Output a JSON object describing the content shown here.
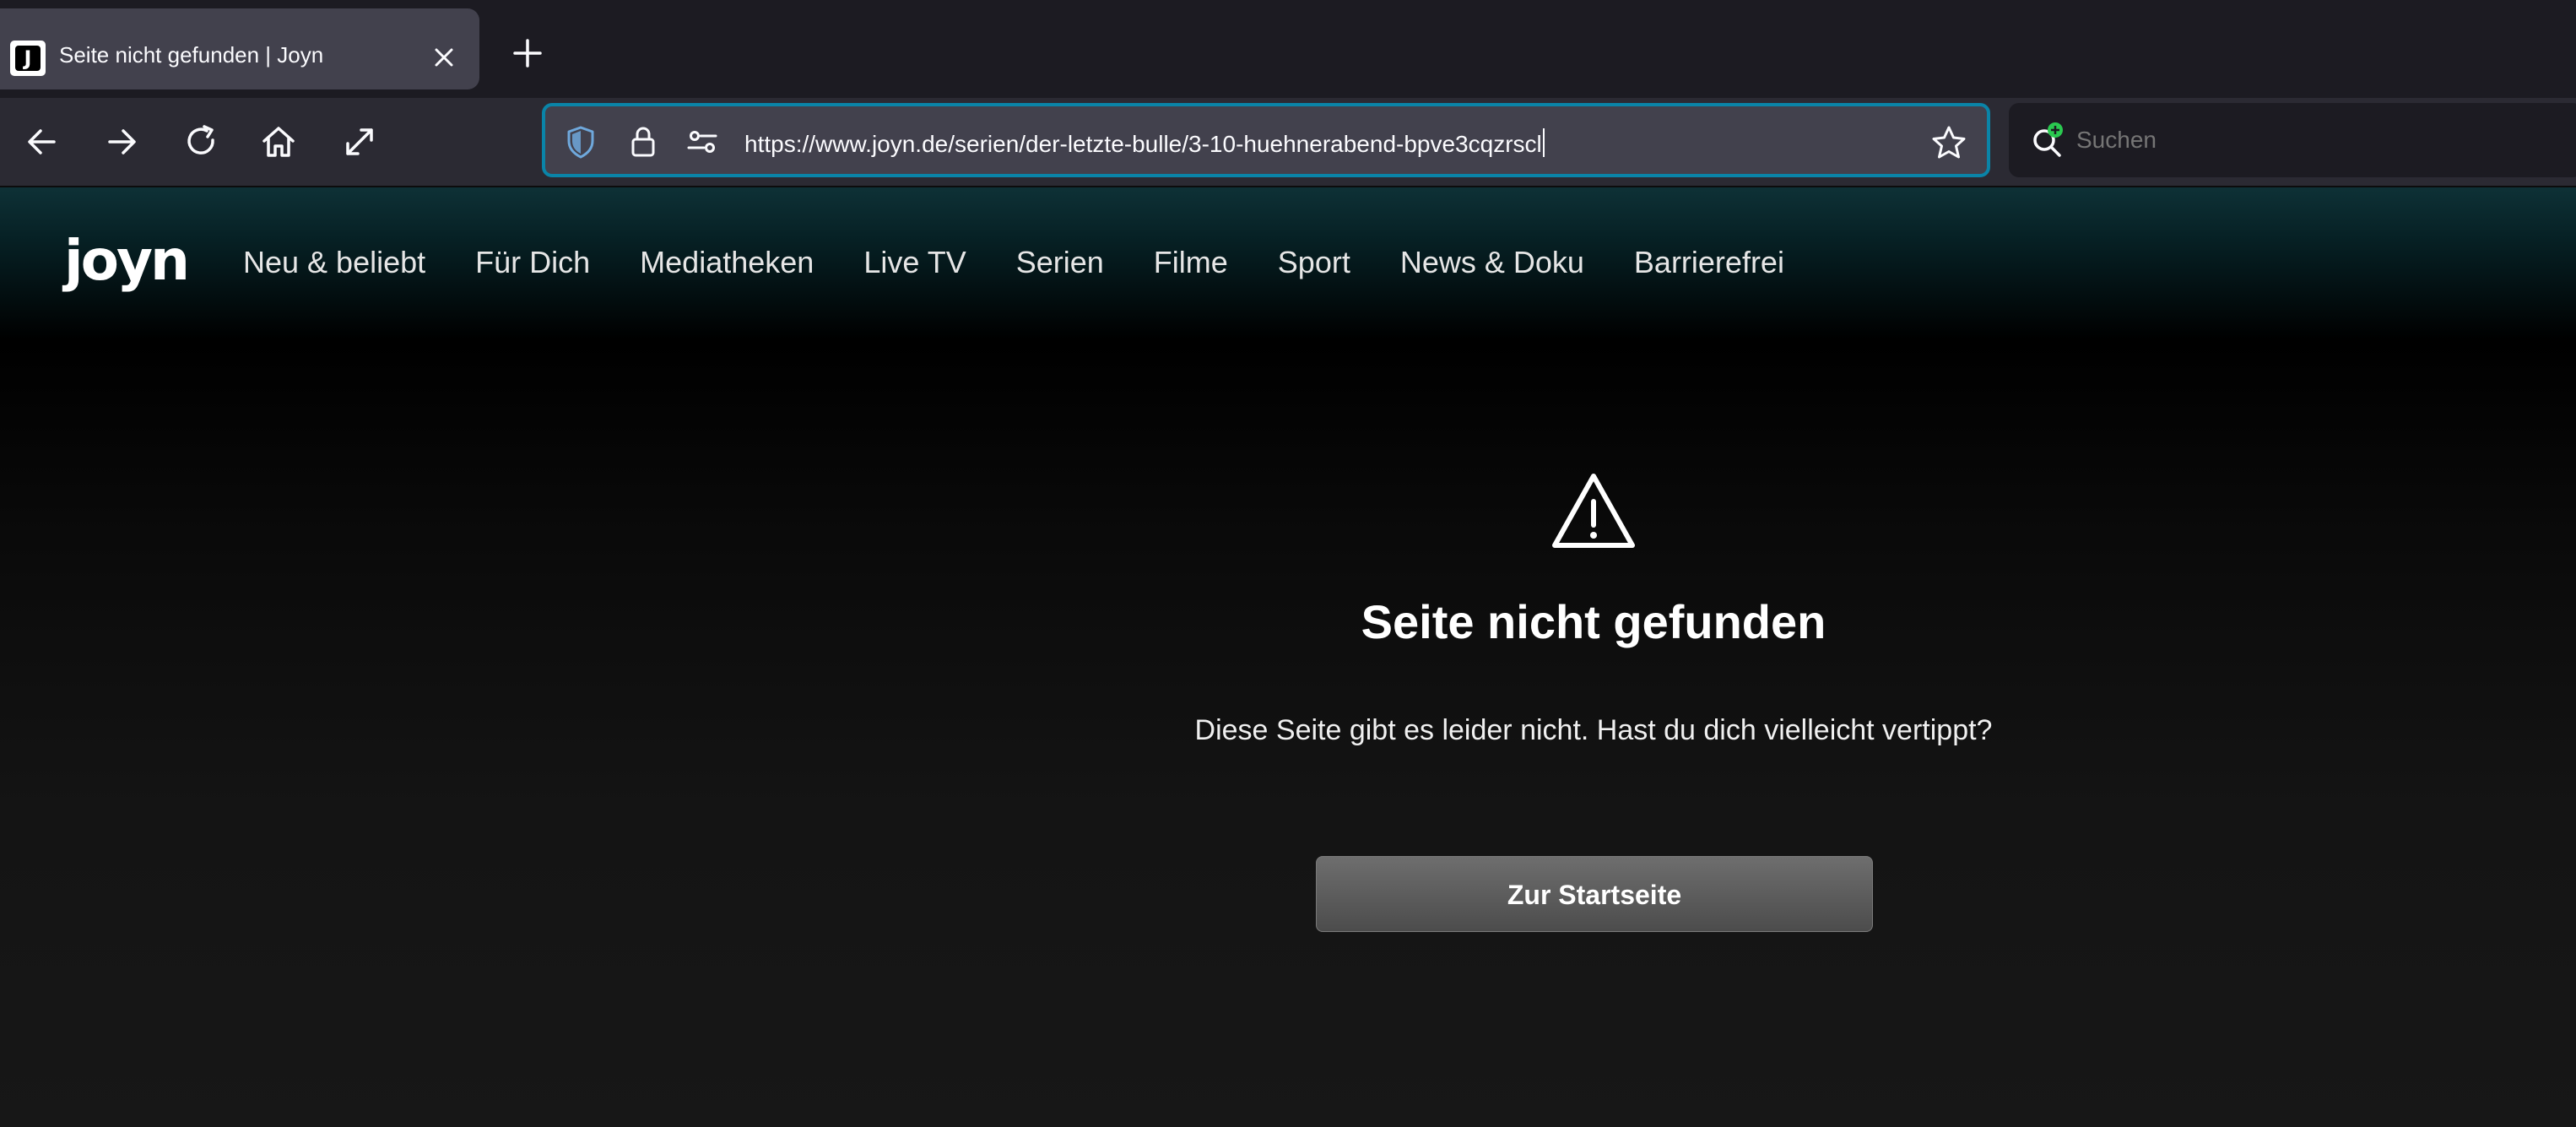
{
  "browser": {
    "tab": {
      "title": "Seite nicht gefunden | Joyn",
      "favicon_letter": "J",
      "favicon_icon": "joyn-favicon-icon",
      "close_icon": "close-icon"
    },
    "new_tab_icon": "plus-icon",
    "nav_icons": [
      "back-arrow-icon",
      "forward-arrow-icon",
      "reload-icon",
      "home-icon",
      "fullscreen-icon"
    ],
    "url": "https://www.joyn.de/serien/der-letzte-bulle/3-10-huehnerabend-bpve3cqzrscl",
    "url_icons": [
      "shield-icon",
      "lock-icon",
      "permissions-icon",
      "bookmark-star-icon"
    ],
    "search": {
      "placeholder": "Suchen",
      "icon": "search-icon"
    },
    "colors": {
      "tabstrip": "#1c1b22",
      "toolbar": "#2b2a33",
      "urlbar_focus": "#0a84a8",
      "shield": "#6fa8dc",
      "search_badge": "#2ac950"
    }
  },
  "site": {
    "logo": "joyn",
    "menu": [
      "Neu & beliebt",
      "Für Dich",
      "Mediatheken",
      "Live TV",
      "Serien",
      "Filme",
      "Sport",
      "News & Doku",
      "Barrierefrei"
    ],
    "colors": {
      "header_top": "#0e3136",
      "background": "#151516"
    }
  },
  "error": {
    "icon": "warning-icon",
    "title": "Seite nicht gefunden",
    "message": "Diese Seite gibt es leider nicht. Hast du dich vielleicht vertippt?",
    "button_label": "Zur Startseite"
  }
}
